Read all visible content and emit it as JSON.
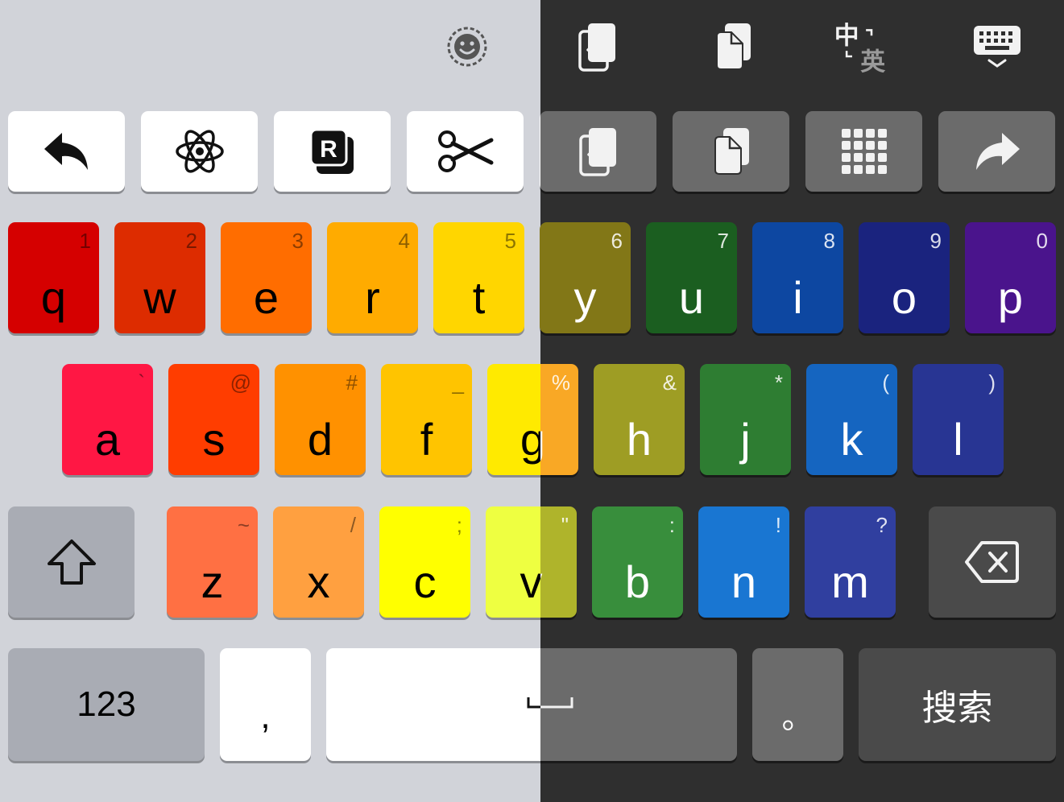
{
  "colors": {
    "light_bg": "#d1d3d9",
    "dark_bg": "#2f2f2f",
    "light_key": "#ffffff",
    "dark_key": "#6b6b6b",
    "light_func_key": "#a9acb4",
    "dark_func_key": "#4a4a4a"
  },
  "toolbar": {
    "icons": [
      "emoji-icon",
      "upload-document-icon",
      "copy-document-icon",
      "zh-en-switch-icon",
      "hide-keyboard-icon"
    ]
  },
  "shortcut_row": [
    {
      "name": "undo-button",
      "icon": "undo-arrow-icon"
    },
    {
      "name": "atom-button",
      "icon": "atom-icon"
    },
    {
      "name": "r-badge-button",
      "icon": "r-badge-icon",
      "text": "R"
    },
    {
      "name": "cut-button",
      "icon": "scissors-icon"
    },
    {
      "name": "upload-button",
      "icon": "upload-document-icon"
    },
    {
      "name": "copy-button",
      "icon": "copy-document-icon"
    },
    {
      "name": "numpad-button",
      "icon": "numpad-grid-icon"
    },
    {
      "name": "redo-button",
      "icon": "redo-arrow-icon"
    }
  ],
  "row1": [
    {
      "letter": "q",
      "sec": "1",
      "color": "#d50000"
    },
    {
      "letter": "w",
      "sec": "2",
      "color": "#dd2c00"
    },
    {
      "letter": "e",
      "sec": "3",
      "color": "#ff6d00"
    },
    {
      "letter": "r",
      "sec": "4",
      "color": "#ffab00"
    },
    {
      "letter": "t",
      "sec": "5",
      "color": "#ffd600"
    },
    {
      "letter": "y",
      "sec": "6",
      "color": "#827717"
    },
    {
      "letter": "u",
      "sec": "7",
      "color": "#1b5e20"
    },
    {
      "letter": "i",
      "sec": "8",
      "color": "#0d47a1"
    },
    {
      "letter": "o",
      "sec": "9",
      "color": "#1a237e"
    },
    {
      "letter": "p",
      "sec": "0",
      "color": "#4a148c"
    }
  ],
  "row2": [
    {
      "letter": "a",
      "sec": "`",
      "color": "#ff1744"
    },
    {
      "letter": "s",
      "sec": "@",
      "color": "#ff3d00"
    },
    {
      "letter": "d",
      "sec": "#",
      "color": "#ff9100"
    },
    {
      "letter": "f",
      "sec": "_",
      "color": "#ffc400"
    },
    {
      "letter": "g",
      "sec": "%",
      "color": "#ffea00",
      "dark_color": "#f9a825"
    },
    {
      "letter": "h",
      "sec": "&",
      "color": "#9e9d24"
    },
    {
      "letter": "j",
      "sec": "*",
      "color": "#2e7d32"
    },
    {
      "letter": "k",
      "sec": "(",
      "color": "#1565c0"
    },
    {
      "letter": "l",
      "sec": ")",
      "color": "#283593"
    }
  ],
  "row3": [
    {
      "letter": "z",
      "sec": "~",
      "color": "#ff7043"
    },
    {
      "letter": "x",
      "sec": "/",
      "color": "#ffa040"
    },
    {
      "letter": "c",
      "sec": ";",
      "color": "#ffff00"
    },
    {
      "letter": "v",
      "sec": "\"",
      "color": "#eeff41",
      "dark_color": "#afb42b"
    },
    {
      "letter": "b",
      "sec": ":",
      "color": "#388e3c"
    },
    {
      "letter": "n",
      "sec": "!",
      "color": "#1976d2"
    },
    {
      "letter": "m",
      "sec": "?",
      "color": "#303f9f"
    }
  ],
  "bottom": {
    "numbers_label": "123",
    "comma_label": ",",
    "space_symbol": "␣",
    "period_label": "。",
    "search_label": "搜索"
  }
}
